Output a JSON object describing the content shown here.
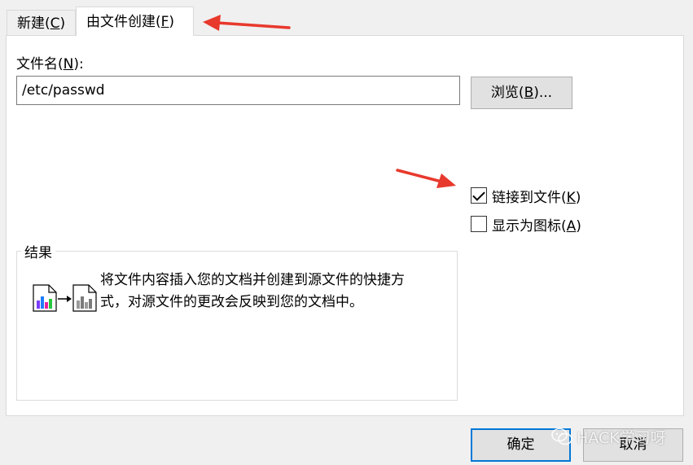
{
  "tabs": [
    {
      "label_pre": "新建(",
      "accel": "C",
      "label_post": ")"
    },
    {
      "label_pre": "由文件创建(",
      "accel": "F",
      "label_post": ")"
    }
  ],
  "filename": {
    "label_pre": "文件名(",
    "accel": "N",
    "label_post": "):",
    "value": "/etc/passwd"
  },
  "browse": {
    "label_pre": "浏览(",
    "accel": "B",
    "label_post": ")..."
  },
  "link_to_file": {
    "label_pre": "链接到文件(",
    "accel": "K",
    "label_post": ")",
    "checked": true
  },
  "display_as_icon": {
    "label_pre": "显示为图标(",
    "accel": "A",
    "label_post": ")",
    "checked": false
  },
  "result": {
    "title": "结果",
    "text_line1": "将文件内容插入您的文档并创建到源文件的快捷方",
    "text_line2": "式，对源文件的更改会反映到您的文档中。"
  },
  "buttons": {
    "ok": "确定",
    "cancel": "取消"
  },
  "watermark": "HACK学习呀",
  "colors": {
    "annotation_arrow": "#e8392d",
    "focus_border": "#0078d7"
  }
}
